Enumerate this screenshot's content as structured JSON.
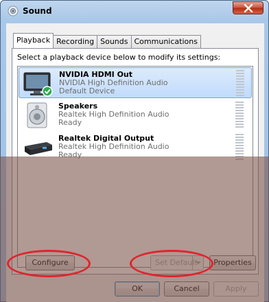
{
  "window": {
    "title": "Sound",
    "close_icon": "close-icon"
  },
  "tabs": [
    {
      "label": "Playback",
      "active": true
    },
    {
      "label": "Recording",
      "active": false
    },
    {
      "label": "Sounds",
      "active": false
    },
    {
      "label": "Communications",
      "active": false
    }
  ],
  "instruction": "Select a playback device below to modify its settings:",
  "devices": [
    {
      "name": "NVIDIA HDMI Out",
      "description": "NVIDIA High Definition Audio",
      "status": "Default Device",
      "icon": "monitor-icon",
      "selected": true
    },
    {
      "name": "Speakers",
      "description": "Realtek High Definition Audio",
      "status": "Ready",
      "icon": "speaker-icon",
      "selected": false
    },
    {
      "name": "Realtek Digital Output",
      "description": "Realtek High Definition Audio",
      "status": "Ready",
      "icon": "digital-receiver-icon",
      "selected": false
    }
  ],
  "buttons": {
    "configure": "Configure",
    "set_default": "Set Default",
    "properties": "Properties",
    "ok": "OK",
    "cancel": "Cancel",
    "apply": "Apply"
  },
  "colors": {
    "highlight_ring": "#e0242c",
    "selection": "#c1dbfc"
  }
}
